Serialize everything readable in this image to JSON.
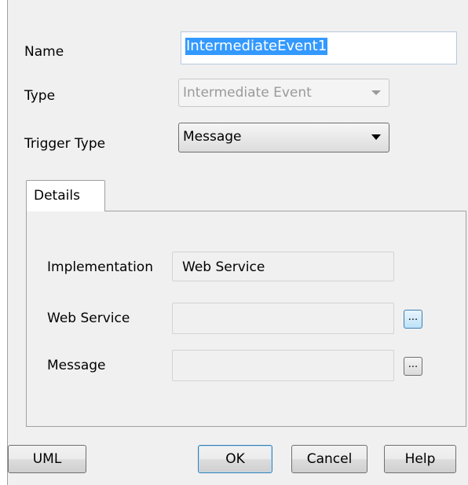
{
  "form": {
    "name_label": "Name",
    "name_value": "IntermediateEvent1",
    "type_label": "Type",
    "type_value": "Intermediate Event",
    "trigger_label": "Trigger Type",
    "trigger_value": "Message"
  },
  "tabs": [
    {
      "label": "Details",
      "selected": true
    }
  ],
  "details": {
    "implementation_label": "Implementation",
    "implementation_value": "Web Service",
    "web_service_label": "Web Service",
    "web_service_value": "",
    "message_label": "Message",
    "message_value": "",
    "ellipsis": "..."
  },
  "buttons": {
    "uml": "UML",
    "ok": "OK",
    "cancel": "Cancel",
    "help": "Help"
  },
  "colors": {
    "selection": "#3399ff",
    "dialog_bg": "#f0f0f0",
    "focus_border": "#3c7fb1"
  }
}
